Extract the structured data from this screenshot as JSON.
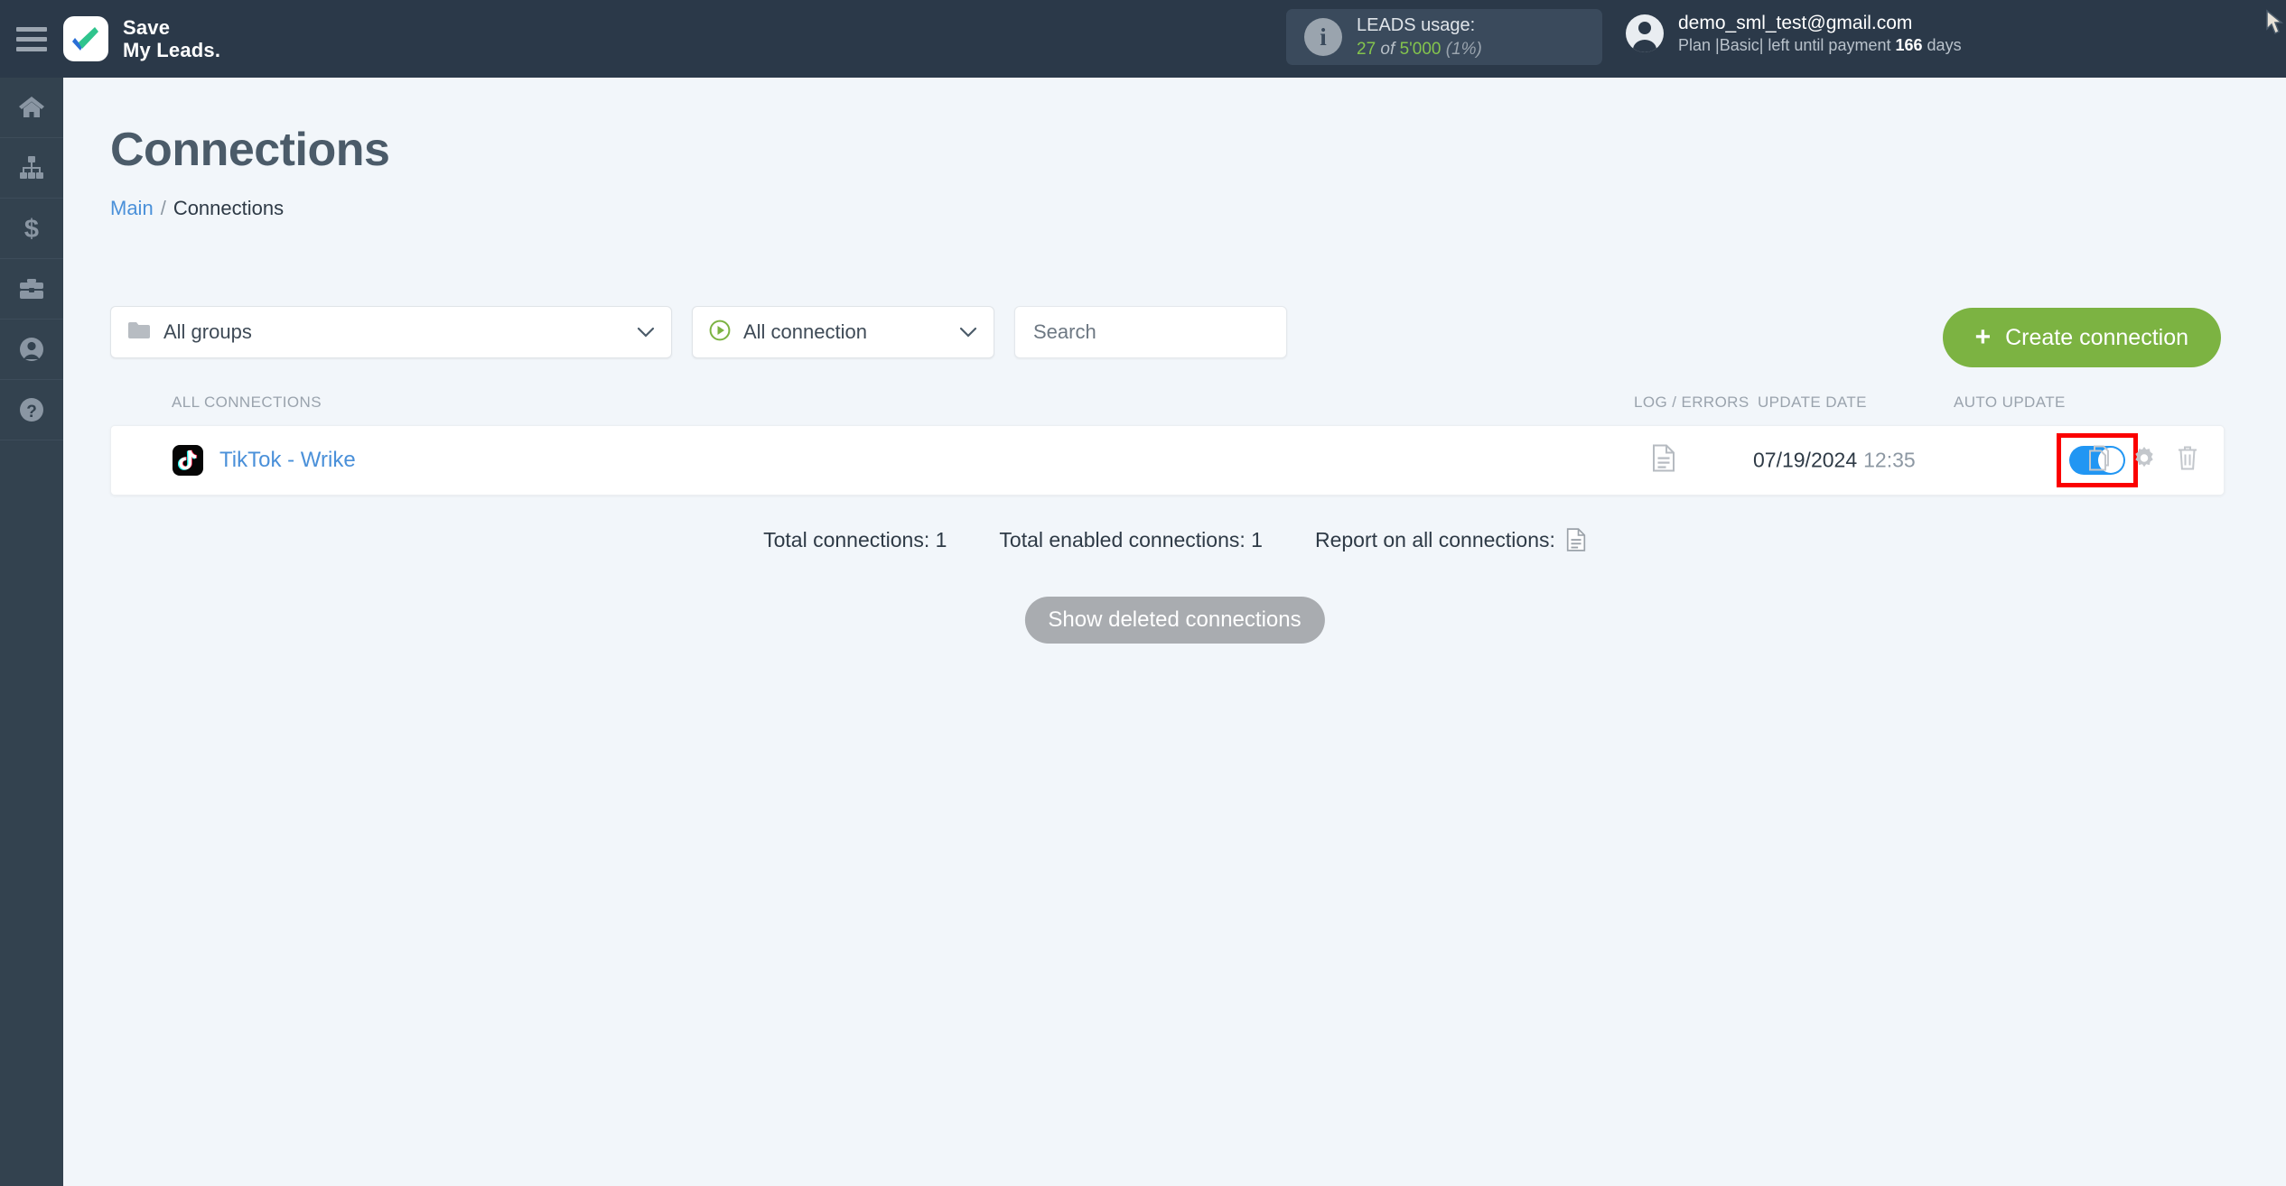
{
  "header": {
    "menu_icon": "hamburger-icon",
    "brand_line1": "Save",
    "brand_line2": "My Leads.",
    "usage": {
      "icon": "info-icon",
      "title": "LEADS usage:",
      "used": "27",
      "of": "of",
      "total": "5'000",
      "percent": "(1%)"
    },
    "account": {
      "icon": "user-avatar-icon",
      "email": "demo_sml_test@gmail.com",
      "plan_prefix": "Plan |Basic| left until payment",
      "plan_days": "166",
      "plan_suffix": "days"
    },
    "cursor": "mouse-cursor"
  },
  "sidebar": {
    "items": [
      {
        "icon": "home-icon",
        "name": "sidebar-item-home"
      },
      {
        "icon": "sitemap-icon",
        "name": "sidebar-item-connections"
      },
      {
        "icon": "dollar-icon",
        "name": "sidebar-item-billing"
      },
      {
        "icon": "briefcase-icon",
        "name": "sidebar-item-business"
      },
      {
        "icon": "user-icon",
        "name": "sidebar-item-account"
      },
      {
        "icon": "question-icon",
        "name": "sidebar-item-help"
      }
    ]
  },
  "page": {
    "title": "Connections",
    "breadcrumb": {
      "root": "Main",
      "separator": "/",
      "current": "Connections"
    }
  },
  "filters": {
    "groups": {
      "icon": "folder-icon",
      "label": "All groups",
      "chevron": "chevron-down-icon"
    },
    "connection": {
      "icon": "play-circle-icon",
      "label": "All connection",
      "chevron": "chevron-down-icon"
    },
    "search": {
      "value": "",
      "placeholder": "Search"
    },
    "create_button": {
      "plus": "+",
      "label": "Create connection"
    }
  },
  "table": {
    "headers": {
      "all_connections": "ALL CONNECTIONS",
      "log_errors": "LOG / ERRORS",
      "update_date": "UPDATE DATE",
      "auto_update": "AUTO UPDATE"
    },
    "rows": [
      {
        "logo": "tiktok-icon",
        "name": "TikTok - Wrike",
        "log_icon": "document-icon",
        "date": "07/19/2024",
        "time": "12:35",
        "auto_update": true,
        "actions": [
          "copy-icon",
          "gear-icon",
          "trash-icon"
        ]
      }
    ]
  },
  "footer": {
    "total_connections": "Total connections: 1",
    "total_enabled": "Total enabled connections: 1",
    "report_label": "Report on all connections:",
    "report_icon": "document-icon",
    "show_deleted": "Show deleted connections"
  },
  "colors": {
    "header_bg": "#2b3949",
    "sidebar_bg": "#33424f",
    "page_bg": "#f2f6fa",
    "accent_green": "#7cb342",
    "link_blue": "#4a90d9",
    "toggle_on": "#2196f3",
    "highlight_red": "#fb0000",
    "usage_green": "#84c44d",
    "gray_button": "#a9acb0"
  }
}
